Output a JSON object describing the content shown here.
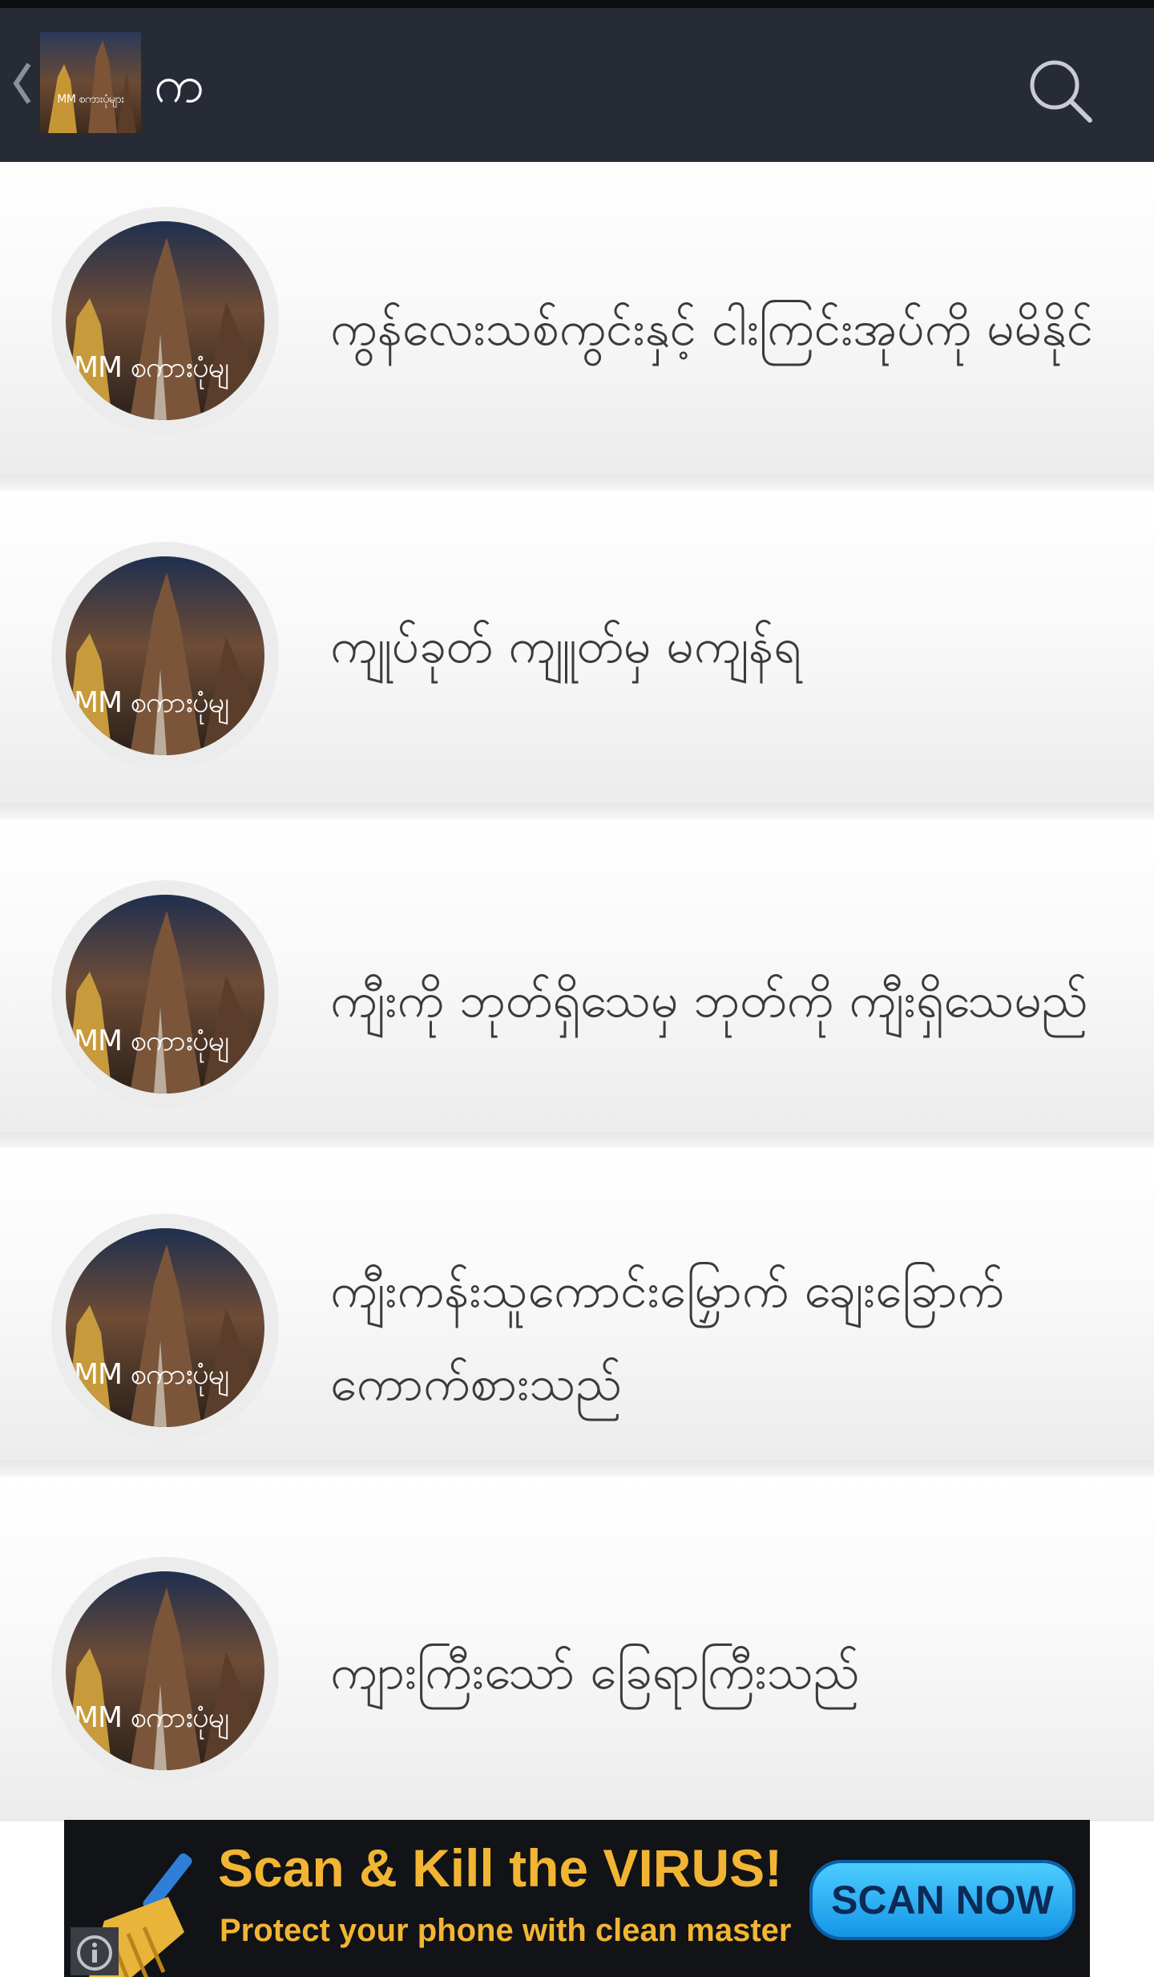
{
  "app_bar": {
    "title": "က",
    "logo_caption": "MM စကားပုံများ",
    "back_icon": "chevron-left-icon",
    "search_icon": "search-icon",
    "background": "#262b35"
  },
  "list": {
    "thumbnail_caption": "MM စကားပုံမျ",
    "items": [
      {
        "title": "ကွန်လေးသစ်ကွင်းနှင့် ငါးကြင်းအုပ်ကို မမိနိုင်"
      },
      {
        "title": "ကျုပ်ခုတ် ကျူတ်မှ မကျန်ရ"
      },
      {
        "title": "ကျီးကို ဘုတ်ရှိသေမှ ဘုတ်ကို ကျီးရှိသေမည်"
      },
      {
        "title": "ကျီးကန်းသူကောင်းမြှောက် ချေးခြောက် ကောက်စားသည်"
      },
      {
        "title": "ကျားကြီးသော် ခြေရာကြီးသည်"
      }
    ]
  },
  "ad": {
    "headline": "Scan & Kill the VIRUS!",
    "subline": "Protect your phone with clean master",
    "button_label": "SCAN NOW",
    "icon": "broom-icon",
    "info_icon": "info-icon",
    "accent": "#f2b533"
  }
}
